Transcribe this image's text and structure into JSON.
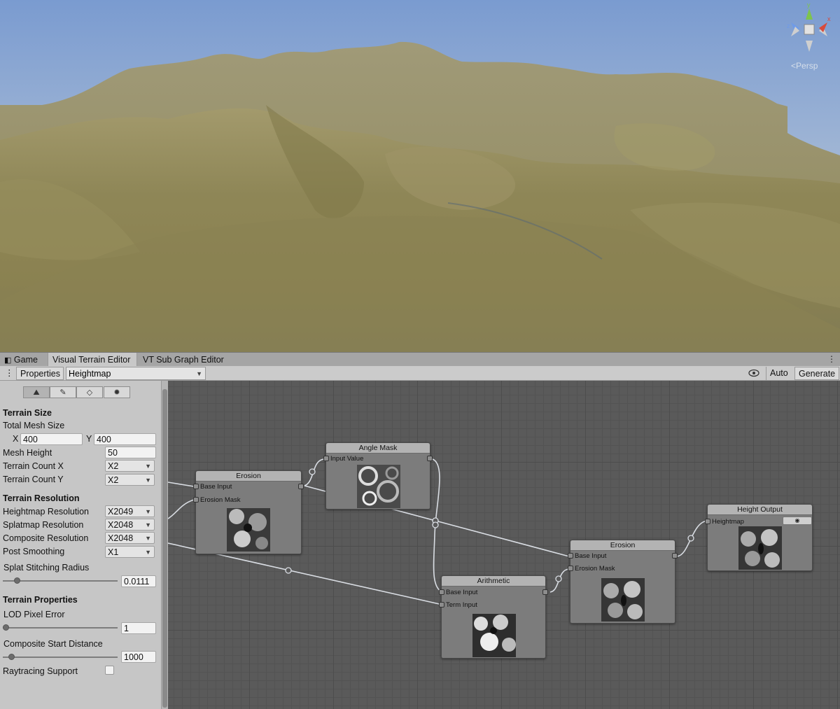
{
  "scene": {
    "gizmo": {
      "axis_y": "y",
      "axis_z": "z",
      "axis_x": "x"
    },
    "view_mode": "Persp",
    "colors": {
      "sky_top": "#7b9dcf",
      "sky_bottom": "#c7cfd9",
      "terrain": "#8d8454"
    }
  },
  "tabs": [
    {
      "label": "Game",
      "icon": "gamepad-icon"
    },
    {
      "label": "Visual Terrain Editor"
    },
    {
      "label": "VT Sub Graph Editor"
    }
  ],
  "toolbar": {
    "menu_icon": "kebab-menu-icon",
    "properties_label": "Properties",
    "graph_select": "Heightmap",
    "eye_icon": "eye-icon",
    "auto_label": "Auto",
    "generate_label": "Generate"
  },
  "panel": {
    "tab_icons": [
      "terrain-icon",
      "paint-icon",
      "cube-icon",
      "gear-icon"
    ],
    "terrain_size": {
      "heading": "Terrain Size",
      "total_mesh_size_label": "Total Mesh Size",
      "x_label": "X",
      "x_value": "400",
      "y_label": "Y",
      "y_value": "400",
      "mesh_height_label": "Mesh Height",
      "mesh_height_value": "50",
      "terrain_count_x_label": "Terrain Count X",
      "terrain_count_x_value": "X2",
      "terrain_count_y_label": "Terrain Count Y",
      "terrain_count_y_value": "X2"
    },
    "terrain_resolution": {
      "heading": "Terrain Resolution",
      "heightmap_label": "Heightmap Resolution",
      "heightmap_value": "X2049",
      "splatmap_label": "Splatmap Resolution",
      "splatmap_value": "X2048",
      "composite_label": "Composite Resolution",
      "composite_value": "X2048",
      "post_smoothing_label": "Post Smoothing",
      "post_smoothing_value": "X1",
      "splat_stitching_label": "Splat Stitching Radius",
      "splat_stitching_value": "0.0111",
      "splat_stitching_fraction": 0.1
    },
    "terrain_properties": {
      "heading": "Terrain Properties",
      "lod_label": "LOD Pixel Error",
      "lod_value": "1",
      "lod_fraction": 0.0,
      "composite_start_label": "Composite Start Distance",
      "composite_start_value": "1000",
      "composite_start_fraction": 0.05,
      "raytracing_label": "Raytracing Support",
      "raytracing_checked": false
    }
  },
  "graph": {
    "nodes": {
      "erosion_1": {
        "title": "Erosion",
        "ports": [
          "Base Input",
          "Erosion Mask"
        ]
      },
      "angle_mask": {
        "title": "Angle Mask",
        "ports": [
          "Input Value"
        ]
      },
      "arithmetic": {
        "title": "Arithmetic",
        "ports": [
          "Base Input",
          "Term Input"
        ]
      },
      "erosion_2": {
        "title": "Erosion",
        "ports": [
          "Base Input",
          "Erosion Mask"
        ]
      },
      "height_output": {
        "title": "Height Output",
        "ports": [
          "Heightmap"
        ],
        "preview_icon": "eye-icon"
      }
    }
  }
}
